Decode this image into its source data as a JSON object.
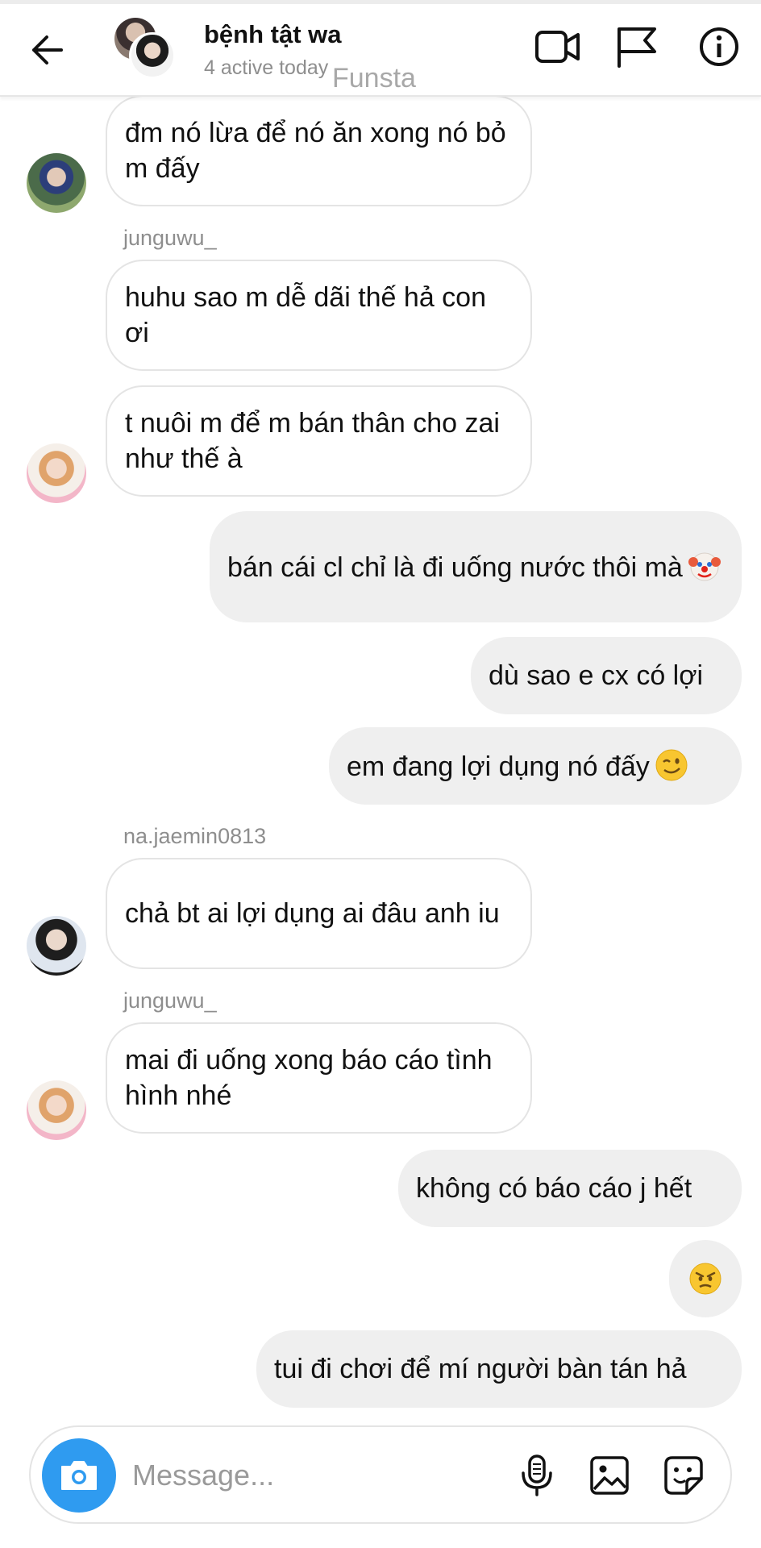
{
  "header": {
    "title": "bệnh tật wa",
    "subtitle": "4 active today",
    "watermark": "Funsta",
    "icons": [
      "arrow-left-icon",
      "video-call-icon",
      "flag-icon",
      "info-icon"
    ]
  },
  "messages": [
    {
      "direction": "in",
      "text": "đm nó lừa để nó ăn xong nó bỏ m đấy"
    },
    {
      "direction": "in",
      "sender": "junguwu_",
      "text": "huhu sao m dễ dãi thế hả con ơi"
    },
    {
      "direction": "in",
      "text": "t nuôi m để m bán thân cho zai như thế à"
    },
    {
      "direction": "out",
      "text": "bán cái cl chỉ là đi uống nước thôi mà",
      "emoji": "clown-face-emoji"
    },
    {
      "direction": "out",
      "text": "dù sao e cx có lợi"
    },
    {
      "direction": "out",
      "text": "em đang lợi dụng nó đấy",
      "emoji": "winking-face-emoji"
    },
    {
      "direction": "in",
      "sender": "na.jaemin0813",
      "text": "chả bt ai lợi dụng ai đâu anh iu"
    },
    {
      "direction": "in",
      "sender": "junguwu_",
      "text": "mai đi uống xong báo cáo tình hình nhé"
    },
    {
      "direction": "out",
      "text": "không có báo cáo j hết"
    },
    {
      "direction": "out",
      "text": "",
      "emoji": "angry-face-emoji"
    },
    {
      "direction": "out",
      "text": "tui đi chơi để mí người bàn tán hả"
    }
  ],
  "composer": {
    "placeholder": "Message...",
    "icons": [
      "camera-icon",
      "microphone-icon",
      "gallery-icon",
      "sticker-icon"
    ]
  },
  "colors": {
    "incoming_bubble": "#ffffff",
    "outgoing_bubble": "#efefef",
    "camera_button": "#2f9bf0",
    "secondary_text": "#8e8e8e"
  }
}
